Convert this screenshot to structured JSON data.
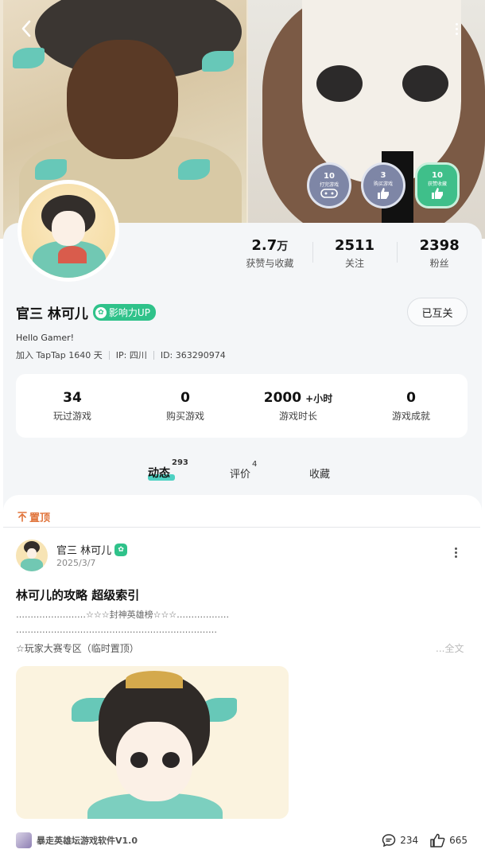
{
  "header": {
    "badges": [
      {
        "count": "10",
        "label": "打完游戏"
      },
      {
        "count": "3",
        "label": "购买游戏"
      },
      {
        "count": "10",
        "label": "获赞收藏"
      }
    ]
  },
  "profile": {
    "stats": [
      {
        "value": "2.7",
        "unit": "万",
        "label": "获赞与收藏"
      },
      {
        "value": "2511",
        "unit": "",
        "label": "关注"
      },
      {
        "value": "2398",
        "unit": "",
        "label": "粉丝"
      }
    ],
    "name": "官三 林可儿",
    "up_tag": "影响力UP",
    "follow_button": "已互关",
    "bio": "Hello Gamer!",
    "joined": "加入 TapTap 1640 天",
    "ip": "IP: 四川",
    "id": "ID: 363290974"
  },
  "game_stats": [
    {
      "value": "34",
      "unit": "",
      "label": "玩过游戏"
    },
    {
      "value": "0",
      "unit": "",
      "label": "购买游戏"
    },
    {
      "value": "2000",
      "unit": "+小时",
      "label": "游戏时长"
    },
    {
      "value": "0",
      "unit": "",
      "label": "游戏成就"
    }
  ],
  "tabs": [
    {
      "label": "动态",
      "count": "293"
    },
    {
      "label": "评价",
      "count": "4"
    },
    {
      "label": "收藏",
      "count": ""
    }
  ],
  "post": {
    "pinned_label": "置顶",
    "author": "官三 林可儿",
    "date": "2025/3/7",
    "title": "林可儿的攻略 超级索引",
    "line1": "……………………☆☆☆封神英雄榜☆☆☆………………",
    "line2": "……………………………………………………………",
    "line3": "☆玩家大赛专区（临时置顶）",
    "fold": "...全文",
    "app_name": "暴走英雄坛游戏软件V1.0",
    "comments": "234",
    "likes": "665"
  },
  "colors": {
    "accent_green": "#2fc28a",
    "tab_underline": "#4ed1c3",
    "pinned": "#e0733a"
  }
}
